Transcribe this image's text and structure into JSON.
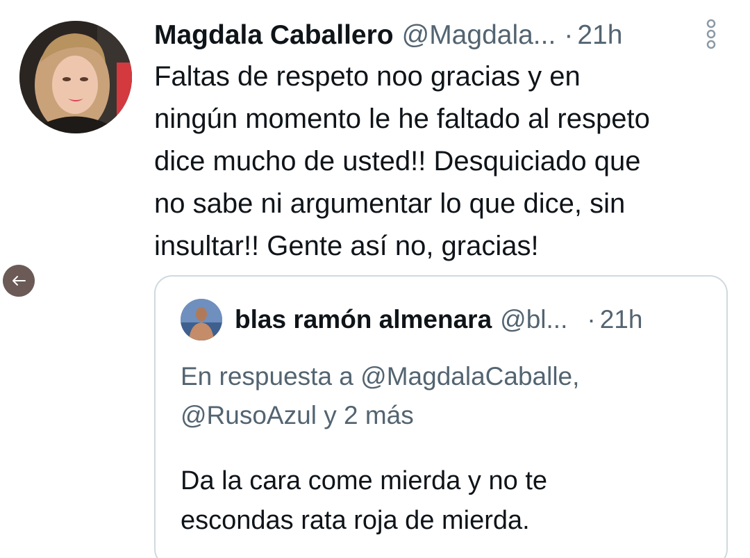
{
  "tweet": {
    "display_name": "Magdala Caballero",
    "handle": "@Magdala...",
    "separator": "·",
    "time": "21h",
    "body_lines": [
      "Faltas de respeto noo gracias y en",
      "ningún momento le he faltado al respeto",
      "dice mucho de usted!! Desquiciado que",
      "no sabe ni argumentar lo que dice, sin",
      "insultar!! Gente así no, gracias!"
    ],
    "avatar_icon": "user-avatar-photo",
    "more_icon": "more-vertical-icon"
  },
  "navigation": {
    "back_icon": "arrow-left-icon"
  },
  "quote": {
    "display_name": "blas ramón almenara",
    "handle": "@bl...",
    "separator": "·",
    "time": "21h",
    "reply_to_lines": [
      "En respuesta a @MagdalaCaballe,",
      "@RusoAzul y 2 más"
    ],
    "body_lines": [
      "Da la cara come mierda y no te",
      "escondas rata roja de mierda."
    ],
    "avatar_icon": "user-avatar-photo"
  },
  "colors": {
    "text_primary": "#0f1419",
    "text_secondary": "#536471",
    "border": "#cfd9de",
    "back_button": "#6b5a56"
  }
}
